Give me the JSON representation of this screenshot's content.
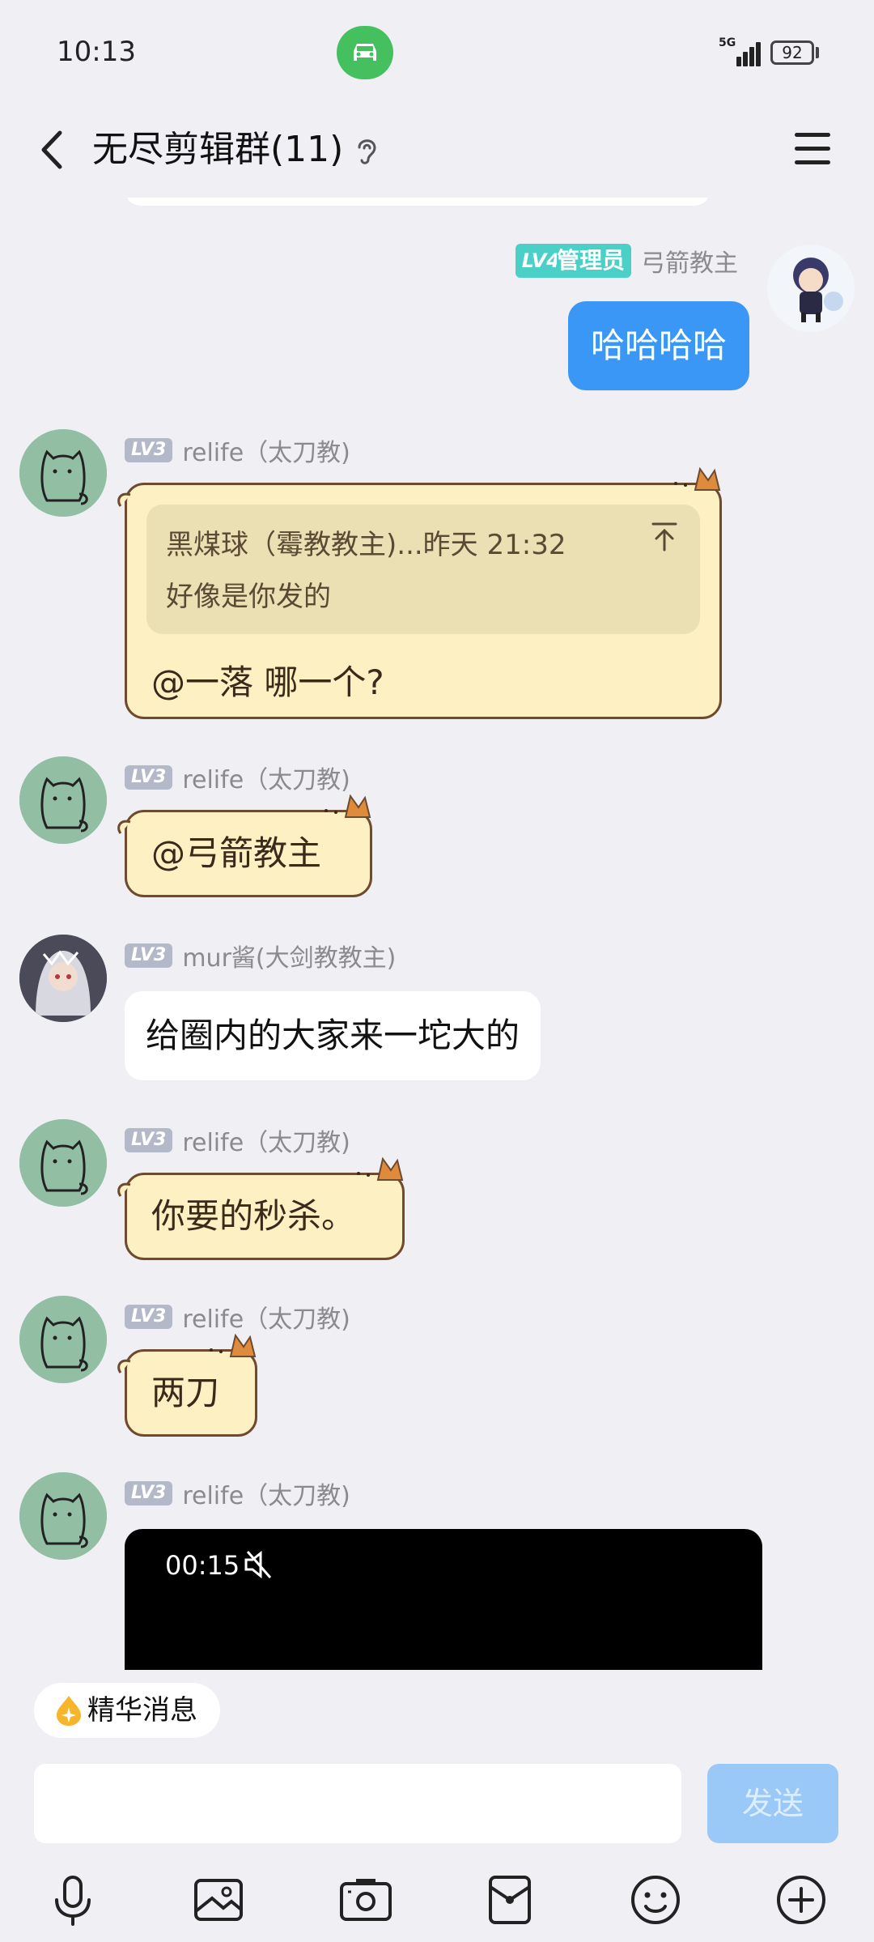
{
  "status_bar": {
    "time": "10:13",
    "network": "5G",
    "battery": "92"
  },
  "header": {
    "title": "无尽剪辑群(11)"
  },
  "messages": [
    {
      "sender": "弓箭教主",
      "level": "LV4",
      "role": "管理员",
      "text": "哈哈哈哈"
    },
    {
      "sender": "relife（太刀教)",
      "level": "LV3",
      "quote_author": "黑煤球（霉教教主)...昨天 21:32",
      "quote_text": "好像是你发的",
      "text": "@一落 哪一个?"
    },
    {
      "sender": "relife（太刀教)",
      "level": "LV3",
      "text": "@弓箭教主"
    },
    {
      "sender": "mur酱(大剑教教主)",
      "level": "LV3",
      "text": "给圈内的大家来一坨大的"
    },
    {
      "sender": "relife（太刀教)",
      "level": "LV3",
      "text": "你要的秒杀。"
    },
    {
      "sender": "relife（太刀教)",
      "level": "LV3",
      "text": "两刀"
    },
    {
      "sender": "relife（太刀教)",
      "level": "LV3",
      "video_duration": "00:15"
    }
  ],
  "bottom": {
    "essence_label": "精华消息",
    "input_placeholder": "",
    "send_label": "发送"
  },
  "colors": {
    "accent_blue": "#3b97f6",
    "admin_teal": "#4bd0c8",
    "cat_bubble": "#fdf1c4"
  }
}
